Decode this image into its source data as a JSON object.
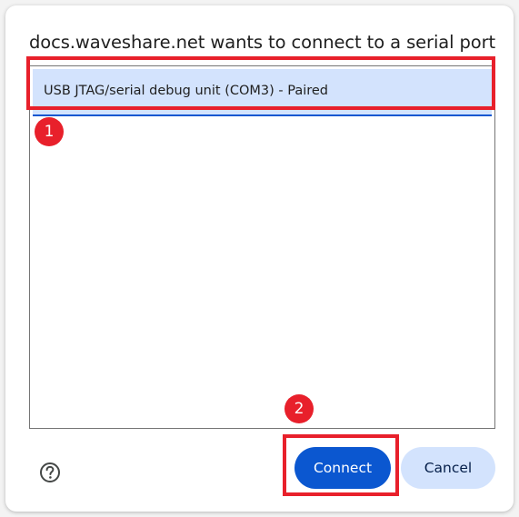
{
  "dialog": {
    "title": "docs.waveshare.net wants to connect to a serial port",
    "ports": [
      {
        "label": "USB JTAG/serial debug unit (COM3) - Paired",
        "selected": true
      }
    ],
    "buttons": {
      "connect": "Connect",
      "cancel": "Cancel"
    },
    "help_icon": "help-circle-icon"
  },
  "annotations": {
    "step1": "1",
    "step2": "2"
  },
  "colors": {
    "primary": "#0b57d0",
    "selection": "#d3e3fd",
    "annotation_red": "#e8202b",
    "text": "#1f1f1f"
  }
}
